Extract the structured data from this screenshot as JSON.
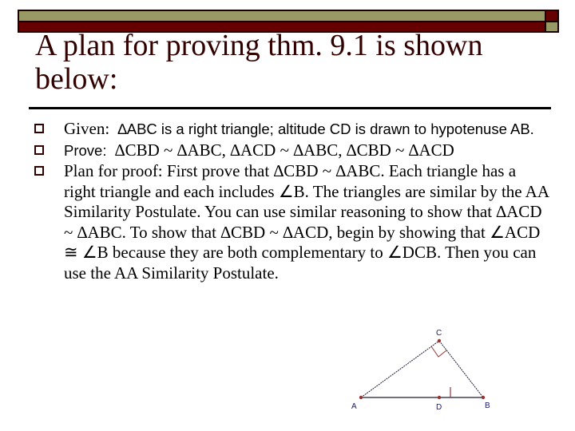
{
  "slide": {
    "title": "A plan for proving thm. 9.1 is shown below:",
    "accent_colors": {
      "olive": "#999966",
      "maroon": "#660000"
    },
    "bullets": [
      {
        "label": "Given:",
        "text": "∆ABC is a right triangle; altitude CD is drawn to hypotenuse AB."
      },
      {
        "label": "Prove:",
        "text": "∆CBD ~ ∆ABC, ∆ACD ~ ∆ABC, ∆CBD ~ ∆ACD"
      },
      {
        "text": "Plan for proof:  First prove that ∆CBD ~ ∆ABC.  Each triangle has a right triangle and each includes ∠B.  The triangles are similar by the AA Similarity Postulate.  You can use similar reasoning to show that ∆ACD ~ ∆ABC.  To show that ∆CBD ~ ∆ACD, begin by showing that ∠ACD ≅ ∠B because they are both complementary to ∠DCB.  Then you can use the AA Similarity Postulate."
      }
    ]
  },
  "diagram": {
    "points": {
      "A": "A",
      "B": "B",
      "C": "C",
      "D": "D"
    },
    "colors": {
      "line": "#1a1a33",
      "point": "#993333",
      "right_angle": "#993333",
      "label": "#1a1a66"
    }
  }
}
